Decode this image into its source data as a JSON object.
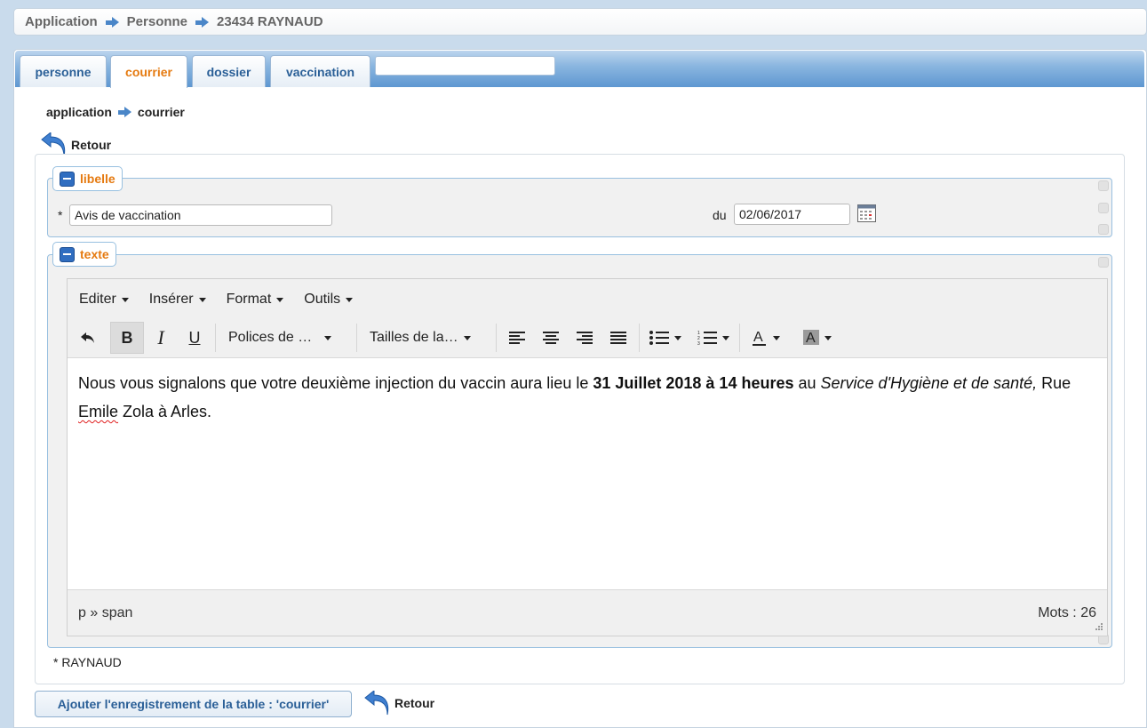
{
  "breadcrumb": [
    "Application",
    "Personne",
    "23434 RAYNAUD"
  ],
  "tabs": [
    {
      "label": "personne",
      "active": false
    },
    {
      "label": "courrier",
      "active": true
    },
    {
      "label": "dossier",
      "active": false
    },
    {
      "label": "vaccination",
      "active": false
    }
  ],
  "sub_breadcrumb": [
    "application",
    "courrier"
  ],
  "retour_label": "Retour",
  "fieldsets": {
    "libelle": {
      "legend": "libelle",
      "required_mark": "*",
      "value": "Avis de vaccination",
      "date_label": "du",
      "date_value": "02/06/2017"
    },
    "texte": {
      "legend": "texte"
    }
  },
  "editor": {
    "menu": [
      "Editer",
      "Insérer",
      "Format",
      "Outils"
    ],
    "toolbar": {
      "bold": "B",
      "italic": "I",
      "underline": "U",
      "font_family": "Polices de …",
      "font_size": "Tailles de la…"
    },
    "content": {
      "text_1": "Nous vous signalons que votre deuxième injection du vaccin aura lieu le ",
      "bold": "31 Juillet 2018 à 14 heures",
      "text_2": " au ",
      "italic": "Service d'Hygiène et de santé,",
      "text_3": " Rue ",
      "misspelled": "Emile",
      "text_4": " Zola à Arles."
    },
    "statusbar": {
      "path": "p » span",
      "word_count": "Mots : 26"
    }
  },
  "footer_required": "* RAYNAUD",
  "add_button_label": "Ajouter l'enregistrement de la table : 'courrier'",
  "colors": {
    "accent_orange": "#e57a10",
    "link_blue": "#2a5f97",
    "tabbar_blue": "#5e97d1",
    "background": "#c9dbec"
  },
  "icons": [
    "arrow-right-icon",
    "back-arrow-icon",
    "collapse-minus-icon",
    "calendar-icon",
    "undo-icon",
    "align-left-icon",
    "align-center-icon",
    "align-right-icon",
    "align-justify-icon",
    "bullet-list-icon",
    "numbered-list-icon",
    "text-color-icon",
    "highlight-color-icon",
    "resize-grip-icon"
  ]
}
